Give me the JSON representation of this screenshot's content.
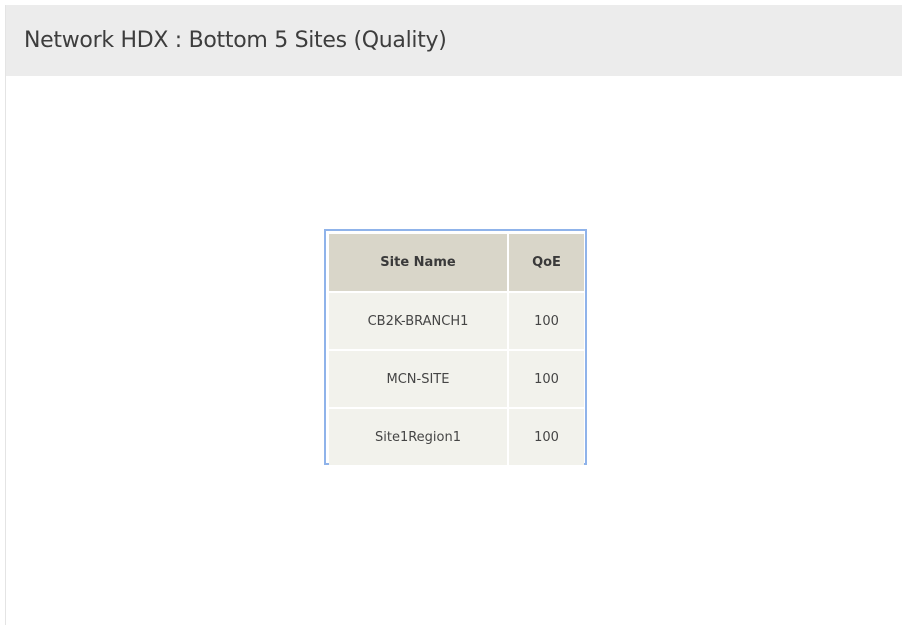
{
  "panel": {
    "title": "Network HDX : Bottom 5 Sites (Quality)"
  },
  "table": {
    "columns": [
      "Site Name",
      "QoE"
    ],
    "rows": [
      {
        "site": "CB2K-BRANCH1",
        "qoe": "100"
      },
      {
        "site": "MCN-SITE",
        "qoe": "100"
      },
      {
        "site": "Site1Region1",
        "qoe": "100"
      }
    ]
  },
  "colors": {
    "header_bg": "#ececec",
    "table_border": "#8fb3ea",
    "table_header_bg": "#d9d6c9",
    "table_cell_bg": "#f2f2ec"
  }
}
